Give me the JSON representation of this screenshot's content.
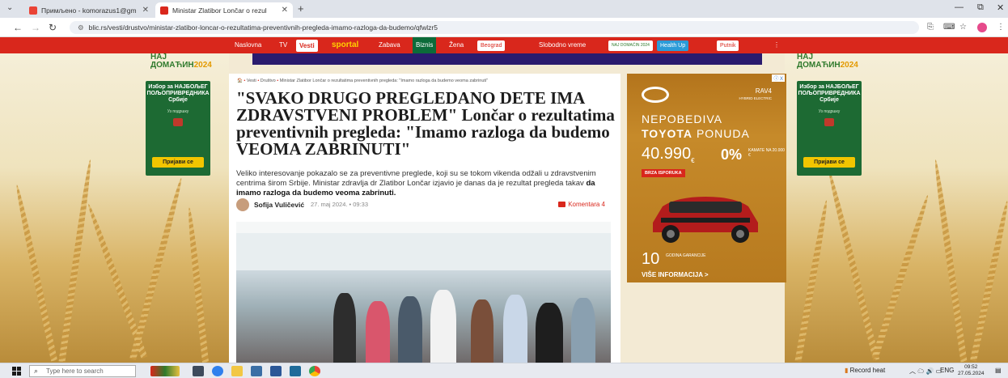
{
  "browser": {
    "tabs": [
      {
        "label": "Примљено - komorazus1@gm",
        "active": false,
        "favicon_color": "#ea4335"
      },
      {
        "label": "Ministar Zlatibor Lončar o rezul",
        "active": true,
        "favicon_color": "#d9271c"
      }
    ],
    "tab_close": "✕",
    "new_tab": "+",
    "url": "blic.rs/vesti/drustvo/ministar-zlatibor-loncar-o-rezultatima-preventivnih-pregleda-imamo-razloga-da-budemo/qfwlzr5",
    "window_controls": {
      "minimize": "—",
      "restore": "⧉",
      "close": "✕"
    }
  },
  "site": {
    "nav": [
      {
        "label": "Naslovna",
        "style": "plain"
      },
      {
        "label": "TV",
        "style": "plain"
      },
      {
        "label": "Vesti",
        "style": "vesti"
      },
      {
        "label": "sportal",
        "style": "sport"
      },
      {
        "label": "Zabava",
        "style": "plain"
      },
      {
        "label": "Biznis",
        "style": "biz"
      },
      {
        "label": "Žena",
        "style": "plain"
      },
      {
        "label": "Beograd",
        "style": "box"
      },
      {
        "label": "Slobodno vreme",
        "style": "plain"
      },
      {
        "label": "NAJ DOMAĆIN 2024",
        "style": "box"
      },
      {
        "label": "Health Up",
        "style": "box"
      },
      {
        "label": "Putnik",
        "style": "box"
      },
      {
        "label": "⋮",
        "style": "plain"
      }
    ],
    "side_logo": {
      "line1": "НАЈ",
      "line2": "ДОМАЋИН",
      "year": "2024"
    },
    "side_promo": {
      "title": "Избор за НАЈБОЉЕГ ПОЉОПРИВРЕДНИКА Србије",
      "small": "Уз подршку",
      "button": "Пријави се"
    }
  },
  "article": {
    "breadcrumb": {
      "home_icon": "🏠",
      "items": [
        "Vesti",
        "Društvo",
        "Ministar Zlatibor Lončar o rezultatima preventivnih pregleda: \"Imamo razloga da budemo veoma zabrinuti\""
      ]
    },
    "headline": "\"SVAKO DRUGO PREGLEDANO DETE IMA ZDRAVSTVENI PROBLEM\" Lončar o rezultatima preventivnih pregleda: \"Imamo razloga da budemo VEOMA ZABRINUTI\"",
    "lede": "Veliko interesovanje pokazalo se za preventivne preglede, koji su se tokom vikenda odžali u zdravstvenim centrima širom Srbije. Ministar zdravlja dr Zlatibor Lončar izjavio je danas da je rezultat pregleda takav ",
    "lede_bold": "da imamo razloga da budemo veoma zabrinuti.",
    "author": "Sofija Vuličević",
    "date": "27. maj 2024.",
    "time": "09:33",
    "comments": "Komentara 4"
  },
  "ad": {
    "model": "RAV4",
    "model_sub": "HYBRID ELECTRIC",
    "line1": "NEPOBEDIVA",
    "line2_bold": "TOYOTA",
    "line2": "PONUDA",
    "price": "40.990",
    "currency": "€",
    "rate": "0%",
    "rate_note": "KAMATE NA 20.000 €",
    "badge": "BRZA ISPORUKA",
    "warranty_num": "10",
    "warranty_text": "GODINA GARANCIJE",
    "cta": "VIŠE INFORMACIJA >",
    "adchoices": "ⓘ X"
  },
  "taskbar": {
    "search_placeholder": "Type here to search",
    "tray_record": "Record heat",
    "tray_lang": "ENG",
    "time": "09:52",
    "date": "27.05.2024"
  }
}
